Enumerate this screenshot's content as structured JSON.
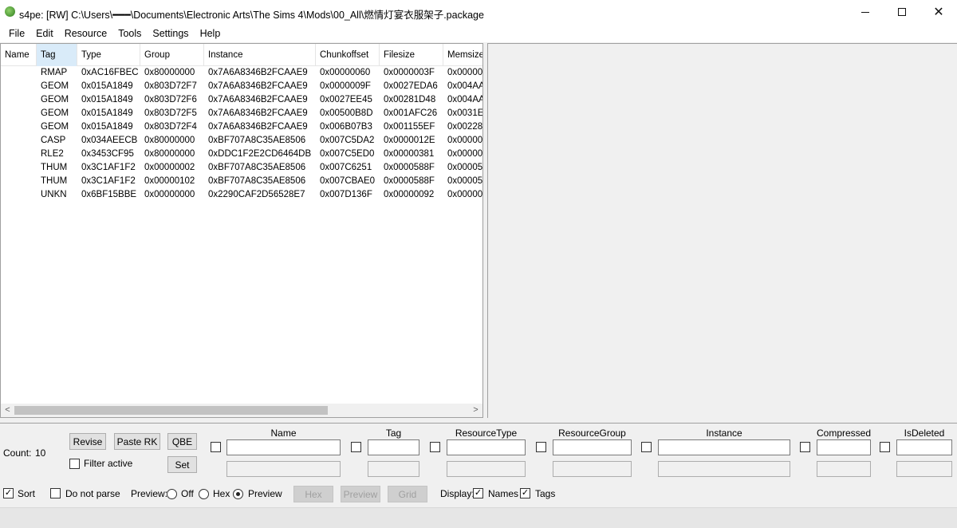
{
  "window": {
    "title": "s4pe: [RW] C:\\Users\\━━━\\Documents\\Electronic Arts\\The Sims 4\\Mods\\00_All\\燃情灯宴衣服架子.package",
    "minimize": "—",
    "maximize": "☐",
    "close": "✕"
  },
  "menu": [
    "File",
    "Edit",
    "Resource",
    "Tools",
    "Settings",
    "Help"
  ],
  "list": {
    "columns": [
      "Name",
      "Tag",
      "Type",
      "Group",
      "Instance",
      "Chunkoffset",
      "Filesize",
      "Memsize"
    ],
    "rows": [
      [
        "",
        "RMAP",
        "0xAC16FBEC",
        "0x80000000",
        "0x7A6A8346B2FCAAE9",
        "0x00000060",
        "0x0000003F",
        "0x000000"
      ],
      [
        "",
        "GEOM",
        "0x015A1849",
        "0x803D72F7",
        "0x7A6A8346B2FCAAE9",
        "0x0000009F",
        "0x0027EDA6",
        "0x004AA"
      ],
      [
        "",
        "GEOM",
        "0x015A1849",
        "0x803D72F6",
        "0x7A6A8346B2FCAAE9",
        "0x0027EE45",
        "0x00281D48",
        "0x004AA"
      ],
      [
        "",
        "GEOM",
        "0x015A1849",
        "0x803D72F5",
        "0x7A6A8346B2FCAAE9",
        "0x00500B8D",
        "0x001AFC26",
        "0x0031E"
      ],
      [
        "",
        "GEOM",
        "0x015A1849",
        "0x803D72F4",
        "0x7A6A8346B2FCAAE9",
        "0x006B07B3",
        "0x001155EF",
        "0x00228"
      ],
      [
        "",
        "CASP",
        "0x034AEECB",
        "0x80000000",
        "0xBF707A8C35AE8506",
        "0x007C5DA2",
        "0x0000012E",
        "0x00000"
      ],
      [
        "",
        "RLE2",
        "0x3453CF95",
        "0x80000000",
        "0xDDC1F2E2CD6464DB",
        "0x007C5ED0",
        "0x00000381",
        "0x00000"
      ],
      [
        "",
        "THUM",
        "0x3C1AF1F2",
        "0x00000002",
        "0xBF707A8C35AE8506",
        "0x007C6251",
        "0x0000588F",
        "0x00005"
      ],
      [
        "",
        "THUM",
        "0x3C1AF1F2",
        "0x00000102",
        "0xBF707A8C35AE8506",
        "0x007CBAE0",
        "0x0000588F",
        "0x00005"
      ],
      [
        "",
        "UNKN",
        "0x6BF15BBE",
        "0x00000000",
        "0x2290CAF2D56528E7",
        "0x007D136F",
        "0x00000092",
        "0x00000"
      ]
    ],
    "scroll_left": "<",
    "scroll_right": ">"
  },
  "bottom": {
    "count_label": "Count:",
    "count_value": "10",
    "revise": "Revise",
    "paste_rk": "Paste RK",
    "qbe": "QBE",
    "set": "Set",
    "filter_active": "Filter active",
    "filter_active_checked": false,
    "fields": [
      "Name",
      "Tag",
      "ResourceType",
      "ResourceGroup",
      "Instance",
      "Compressed",
      "IsDeleted"
    ],
    "sort_label": "Sort",
    "sort_checked": true,
    "do_not_parse_label": "Do not parse",
    "do_not_parse_checked": false,
    "preview_label": "Preview:",
    "preview_off": "Off",
    "preview_hex": "Hex",
    "preview_preview": "Preview",
    "preview_selected": "Preview",
    "hex_btn": "Hex",
    "preview_btn": "Preview",
    "grid_btn": "Grid",
    "display_label": "Display:",
    "names_label": "Names",
    "names_checked": true,
    "tags_label": "Tags",
    "tags_checked": true,
    "check_mark": "✓"
  }
}
